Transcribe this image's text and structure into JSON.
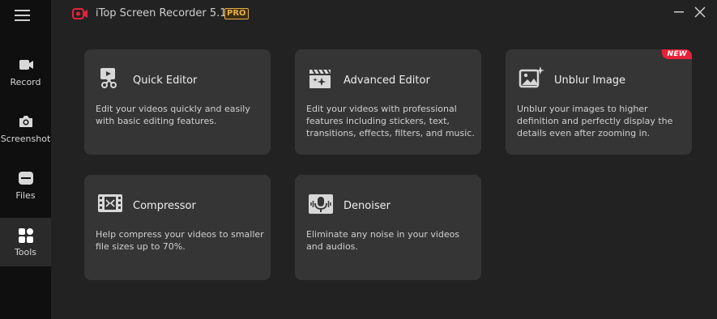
{
  "app": {
    "title": "iTop Screen Recorder 5.1",
    "badge": "PRO",
    "accent": "#e8213a",
    "badge_color": "#e8b04a"
  },
  "sidebar": {
    "items": [
      {
        "label": "Record",
        "icon": "camcorder-icon"
      },
      {
        "label": "Screenshot",
        "icon": "camera-icon"
      },
      {
        "label": "Files",
        "icon": "folder-icon"
      },
      {
        "label": "Tools",
        "icon": "tools-grid-icon",
        "active": true
      }
    ]
  },
  "tools": [
    {
      "title": "Quick Editor",
      "desc": "Edit your videos quickly and easily with basic editing features.",
      "icon": "scissors-video-icon"
    },
    {
      "title": "Advanced Editor",
      "desc": "Edit your videos with professional features including stickers, text, transitions, effects, filters, and music.",
      "icon": "clapperboard-icon"
    },
    {
      "title": "Unblur Image",
      "desc": "Unblur your images to higher definition and perfectly display the details even after zooming in.",
      "icon": "image-sparkle-icon",
      "badge": "NEW"
    },
    {
      "title": "Compressor",
      "desc": "Help compress your videos to smaller file sizes up to 70%.",
      "icon": "film-compress-icon"
    },
    {
      "title": "Denoiser",
      "desc": "Eliminate any noise in your videos and audios.",
      "icon": "microphone-icon"
    }
  ]
}
